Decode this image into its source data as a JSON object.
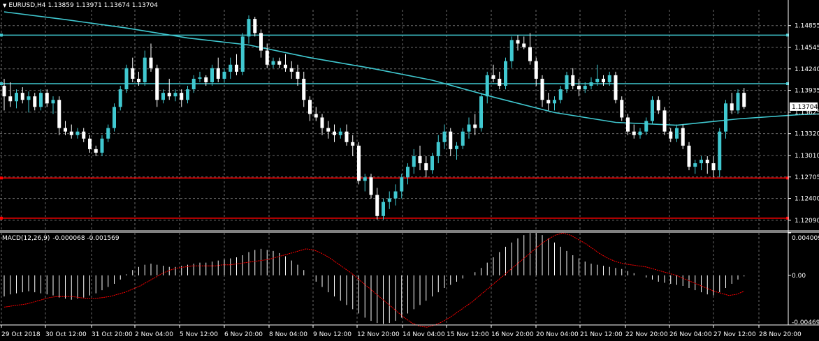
{
  "header": {
    "symbol_tf": "EURUSD,H4",
    "ohlc": "1.13859 1.13971 1.13674 1.13704"
  },
  "macd_header": {
    "name": "MACD(12,26,9)",
    "values": "-0.000068 -0.001569"
  },
  "price_axis": {
    "ticks": [
      "1.14855",
      "1.14545",
      "1.14240",
      "1.13935",
      "1.13625",
      "1.13320",
      "1.13010",
      "1.12705",
      "1.12400",
      "1.12090"
    ],
    "current_price_label": "1.13704"
  },
  "macd_axis": {
    "ticks": [
      "0.004009",
      "0.00",
      "-0.00469"
    ]
  },
  "time_axis": {
    "ticks": [
      "29 Oct 2018",
      "30 Oct 12:00",
      "31 Oct 20:00",
      "2 Nov 04:00",
      "5 Nov 12:00",
      "6 Nov 20:00",
      "8 Nov 04:00",
      "9 Nov 12:00",
      "12 Nov 20:00",
      "14 Nov 04:00",
      "15 Nov 12:00",
      "16 Nov 20:00",
      "20 Nov 04:00",
      "21 Nov 12:00",
      "22 Nov 20:00",
      "26 Nov 04:00",
      "27 Nov 12:00",
      "28 Nov 20:00"
    ]
  },
  "horizontal_lines": [
    {
      "kind": "resistance",
      "price": 1.1472,
      "color": "#40c8d0"
    },
    {
      "kind": "resistance",
      "price": 1.1403,
      "color": "#40c8d0"
    },
    {
      "kind": "support",
      "price": 1.1269,
      "color": "#ff0000"
    },
    {
      "kind": "support",
      "price": 1.1212,
      "color": "#ff0000"
    }
  ],
  "colors": {
    "background": "#000000",
    "grid": "#6a6a6a",
    "bull_candle": "#40c8d0",
    "bear_candle": "#ffffff",
    "moving_average": "#40c8d0",
    "macd_histogram": "#ffffff",
    "macd_signal": "#ff0000"
  },
  "chart_data": {
    "type": "candlestick",
    "symbol": "EURUSD",
    "timeframe": "H4",
    "title": "EURUSD,H4",
    "ylim": [
      1.1195,
      1.1508
    ],
    "x_range": [
      "29 Oct 2018",
      "28 Nov 20:00"
    ],
    "grid": true,
    "indicators": [
      {
        "name": "Moving Average",
        "points": [
          [
            0,
            1.1505
          ],
          [
            10,
            1.1494
          ],
          [
            20,
            1.1482
          ],
          [
            30,
            1.1468
          ],
          [
            40,
            1.1458
          ],
          [
            50,
            1.144
          ],
          [
            60,
            1.1425
          ],
          [
            70,
            1.1408
          ],
          [
            80,
            1.1384
          ],
          [
            90,
            1.1362
          ],
          [
            100,
            1.1348
          ],
          [
            110,
            1.1344
          ],
          [
            120,
            1.1353
          ],
          [
            130,
            1.1359
          ],
          [
            140,
            1.1362
          ],
          [
            150,
            1.1366
          ],
          [
            160,
            1.1365
          ],
          [
            170,
            1.1357
          ],
          [
            175,
            1.135
          ]
        ]
      },
      {
        "name": "MACD(12,26,9)",
        "main": -6.8e-05,
        "signal": -0.001569,
        "range": [
          -0.00469,
          0.004009
        ]
      }
    ],
    "candles": [
      [
        1.14,
        1.141,
        1.1365,
        1.1385
      ],
      [
        1.1385,
        1.1405,
        1.137,
        1.1378
      ],
      [
        1.1378,
        1.1395,
        1.1368,
        1.139
      ],
      [
        1.139,
        1.1398,
        1.1375,
        1.138
      ],
      [
        1.138,
        1.1392,
        1.1362,
        1.1385
      ],
      [
        1.1385,
        1.139,
        1.1365,
        1.137
      ],
      [
        1.137,
        1.1395,
        1.1365,
        1.139
      ],
      [
        1.139,
        1.1395,
        1.137,
        1.1375
      ],
      [
        1.1375,
        1.1385,
        1.136,
        1.138
      ],
      [
        1.138,
        1.1385,
        1.133,
        1.134
      ],
      [
        1.134,
        1.135,
        1.133,
        1.1335
      ],
      [
        1.1335,
        1.1345,
        1.1325,
        1.133
      ],
      [
        1.133,
        1.134,
        1.1325,
        1.1335
      ],
      [
        1.1335,
        1.134,
        1.132,
        1.1325
      ],
      [
        1.1325,
        1.133,
        1.1305,
        1.131
      ],
      [
        1.131,
        1.1315,
        1.13,
        1.1305
      ],
      [
        1.1305,
        1.133,
        1.13,
        1.1325
      ],
      [
        1.1325,
        1.1345,
        1.132,
        1.134
      ],
      [
        1.134,
        1.1375,
        1.1335,
        1.137
      ],
      [
        1.137,
        1.14,
        1.1365,
        1.1395
      ],
      [
        1.1395,
        1.143,
        1.139,
        1.1425
      ],
      [
        1.1425,
        1.144,
        1.1405,
        1.141
      ],
      [
        1.141,
        1.142,
        1.14,
        1.1405
      ],
      [
        1.1405,
        1.145,
        1.14,
        1.144
      ],
      [
        1.144,
        1.146,
        1.142,
        1.1425
      ],
      [
        1.1425,
        1.143,
        1.137,
        1.138
      ],
      [
        1.138,
        1.1395,
        1.1375,
        1.139
      ],
      [
        1.139,
        1.141,
        1.138,
        1.1385
      ],
      [
        1.1385,
        1.1395,
        1.1378,
        1.139
      ],
      [
        1.139,
        1.1395,
        1.137,
        1.138
      ],
      [
        1.138,
        1.14,
        1.1375,
        1.1395
      ],
      [
        1.1395,
        1.1415,
        1.139,
        1.141
      ],
      [
        1.141,
        1.142,
        1.1405,
        1.1412
      ],
      [
        1.1412,
        1.1415,
        1.14,
        1.1405
      ],
      [
        1.1405,
        1.143,
        1.14,
        1.1425
      ],
      [
        1.1425,
        1.144,
        1.1405,
        1.141
      ],
      [
        1.141,
        1.1425,
        1.1405,
        1.142
      ],
      [
        1.142,
        1.144,
        1.141,
        1.143
      ],
      [
        1.143,
        1.1445,
        1.1415,
        1.142
      ],
      [
        1.142,
        1.1475,
        1.1415,
        1.147
      ],
      [
        1.147,
        1.15,
        1.146,
        1.1495
      ],
      [
        1.1495,
        1.1498,
        1.147,
        1.1475
      ],
      [
        1.1475,
        1.148,
        1.144,
        1.145
      ],
      [
        1.145,
        1.146,
        1.1425,
        1.143
      ],
      [
        1.143,
        1.144,
        1.1425,
        1.1435
      ],
      [
        1.1435,
        1.144,
        1.1425,
        1.143
      ],
      [
        1.143,
        1.1445,
        1.142,
        1.1425
      ],
      [
        1.1425,
        1.1435,
        1.141,
        1.142
      ],
      [
        1.142,
        1.143,
        1.14,
        1.141
      ],
      [
        1.141,
        1.142,
        1.137,
        1.138
      ],
      [
        1.138,
        1.1385,
        1.135,
        1.136
      ],
      [
        1.136,
        1.137,
        1.135,
        1.1355
      ],
      [
        1.1355,
        1.136,
        1.133,
        1.134
      ],
      [
        1.134,
        1.135,
        1.1325,
        1.1335
      ],
      [
        1.1335,
        1.1345,
        1.132,
        1.133
      ],
      [
        1.133,
        1.134,
        1.1325,
        1.1335
      ],
      [
        1.1335,
        1.1345,
        1.1315,
        1.132
      ],
      [
        1.132,
        1.133,
        1.13,
        1.1315
      ],
      [
        1.1315,
        1.132,
        1.126,
        1.1265
      ],
      [
        1.1265,
        1.1275,
        1.125,
        1.127
      ],
      [
        1.127,
        1.1275,
        1.124,
        1.1245
      ],
      [
        1.1245,
        1.1255,
        1.121,
        1.1215
      ],
      [
        1.1215,
        1.124,
        1.121,
        1.1235
      ],
      [
        1.1235,
        1.125,
        1.1225,
        1.124
      ],
      [
        1.124,
        1.126,
        1.123,
        1.125
      ],
      [
        1.125,
        1.1275,
        1.124,
        1.127
      ],
      [
        1.127,
        1.129,
        1.126,
        1.1285
      ],
      [
        1.1285,
        1.131,
        1.1275,
        1.13
      ],
      [
        1.13,
        1.1315,
        1.128,
        1.129
      ],
      [
        1.129,
        1.13,
        1.127,
        1.128
      ],
      [
        1.128,
        1.1305,
        1.1275,
        1.13
      ],
      [
        1.13,
        1.133,
        1.129,
        1.132
      ],
      [
        1.132,
        1.1345,
        1.131,
        1.1335
      ],
      [
        1.1335,
        1.134,
        1.13,
        1.131
      ],
      [
        1.131,
        1.132,
        1.1295,
        1.1315
      ],
      [
        1.1315,
        1.134,
        1.131,
        1.1335
      ],
      [
        1.1335,
        1.1355,
        1.1325,
        1.1345
      ],
      [
        1.1345,
        1.136,
        1.133,
        1.134
      ],
      [
        1.134,
        1.139,
        1.1335,
        1.1385
      ],
      [
        1.1385,
        1.142,
        1.1375,
        1.1415
      ],
      [
        1.1415,
        1.143,
        1.1405,
        1.141
      ],
      [
        1.141,
        1.142,
        1.1395,
        1.14
      ],
      [
        1.14,
        1.144,
        1.1395,
        1.1435
      ],
      [
        1.1435,
        1.147,
        1.1425,
        1.1465
      ],
      [
        1.1465,
        1.1472,
        1.145,
        1.146
      ],
      [
        1.146,
        1.147,
        1.1452,
        1.1455
      ],
      [
        1.1455,
        1.1475,
        1.143,
        1.1435
      ],
      [
        1.1435,
        1.144,
        1.14,
        1.141
      ],
      [
        1.141,
        1.1415,
        1.137,
        1.138
      ],
      [
        1.138,
        1.139,
        1.1365,
        1.1375
      ],
      [
        1.1375,
        1.1385,
        1.1365,
        1.138
      ],
      [
        1.138,
        1.14,
        1.1375,
        1.1395
      ],
      [
        1.1395,
        1.142,
        1.139,
        1.1415
      ],
      [
        1.1415,
        1.1425,
        1.1395,
        1.14
      ],
      [
        1.14,
        1.141,
        1.1385,
        1.1395
      ],
      [
        1.1395,
        1.1405,
        1.139,
        1.14
      ],
      [
        1.14,
        1.1412,
        1.1395,
        1.1405
      ],
      [
        1.1405,
        1.143,
        1.14,
        1.141
      ],
      [
        1.141,
        1.1415,
        1.14,
        1.1405
      ],
      [
        1.1405,
        1.142,
        1.14,
        1.1415
      ],
      [
        1.1415,
        1.142,
        1.1375,
        1.138
      ],
      [
        1.138,
        1.1385,
        1.135,
        1.1355
      ],
      [
        1.1355,
        1.136,
        1.133,
        1.1335
      ],
      [
        1.1335,
        1.1345,
        1.1325,
        1.133
      ],
      [
        1.133,
        1.134,
        1.1325,
        1.1335
      ],
      [
        1.1335,
        1.1355,
        1.133,
        1.135
      ],
      [
        1.135,
        1.1385,
        1.1345,
        1.138
      ],
      [
        1.138,
        1.1385,
        1.136,
        1.1365
      ],
      [
        1.1365,
        1.137,
        1.133,
        1.1335
      ],
      [
        1.1335,
        1.134,
        1.132,
        1.1325
      ],
      [
        1.1325,
        1.1345,
        1.132,
        1.134
      ],
      [
        1.134,
        1.1345,
        1.131,
        1.1315
      ],
      [
        1.1315,
        1.132,
        1.128,
        1.1285
      ],
      [
        1.1285,
        1.1295,
        1.1275,
        1.129
      ],
      [
        1.129,
        1.13,
        1.128,
        1.1295
      ],
      [
        1.1295,
        1.13,
        1.1275,
        1.129
      ],
      [
        1.129,
        1.13,
        1.127,
        1.128
      ],
      [
        1.128,
        1.134,
        1.127,
        1.1335
      ],
      [
        1.1335,
        1.138,
        1.1325,
        1.1375
      ],
      [
        1.1375,
        1.139,
        1.136,
        1.1365
      ],
      [
        1.1365,
        1.1395,
        1.136,
        1.139
      ],
      [
        1.139,
        1.1397,
        1.1367,
        1.137
      ]
    ],
    "macd_histogram": [
      -0.002,
      -0.0018,
      -0.0017,
      -0.0016,
      -0.0015,
      -0.0016,
      -0.0017,
      -0.0018,
      -0.0019,
      -0.0021,
      -0.0022,
      -0.0023,
      -0.0022,
      -0.0021,
      -0.0019,
      -0.0017,
      -0.0014,
      -0.0011,
      -0.0008,
      -0.0004,
      0.0001,
      0.0005,
      0.0008,
      0.001,
      0.0011,
      0.001,
      0.0009,
      0.0008,
      0.0008,
      0.0009,
      0.001,
      0.0011,
      0.0012,
      0.0012,
      0.0013,
      0.0014,
      0.0015,
      0.0016,
      0.0017,
      0.0019,
      0.0022,
      0.0024,
      0.0025,
      0.0024,
      0.0023,
      0.0021,
      0.0018,
      0.0014,
      0.001,
      0.0005,
      0.0,
      -0.0006,
      -0.0011,
      -0.0016,
      -0.002,
      -0.0024,
      -0.0028,
      -0.0032,
      -0.0036,
      -0.004,
      -0.0043,
      -0.0045,
      -0.0046,
      -0.0045,
      -0.0043,
      -0.004,
      -0.0036,
      -0.0032,
      -0.0028,
      -0.0024,
      -0.002,
      -0.0016,
      -0.0012,
      -0.0009,
      -0.0006,
      -0.0003,
      0.0,
      0.0003,
      0.0007,
      0.0012,
      0.0017,
      0.0022,
      0.0027,
      0.0031,
      0.0035,
      0.0038,
      0.004,
      0.004,
      0.0038,
      0.0035,
      0.0031,
      0.0027,
      0.0023,
      0.0019,
      0.0016,
      0.0013,
      0.0011,
      0.001,
      0.0009,
      0.0008,
      0.0007,
      0.0006,
      0.0004,
      0.0002,
      0.0,
      -0.0002,
      -0.0004,
      -0.0006,
      -0.0007,
      -0.0008,
      -0.0009,
      -0.001,
      -0.0012,
      -0.0014,
      -0.0016,
      -0.0018,
      -0.0019,
      -0.0016,
      -0.0012,
      -0.0008,
      -0.0004,
      -0.0001
    ],
    "macd_signal": [
      -0.003,
      -0.0029,
      -0.0028,
      -0.0027,
      -0.0025,
      -0.0023,
      -0.0021,
      -0.002,
      -0.002,
      -0.002,
      -0.0021,
      -0.0022,
      -0.0022,
      -0.0021,
      -0.002,
      -0.0018,
      -0.0016,
      -0.0013,
      -0.001,
      -0.0006,
      -0.0002,
      0.0002,
      0.0005,
      0.0007,
      0.0008,
      0.0009,
      0.0009,
      0.0009,
      0.0009,
      0.001,
      0.001,
      0.0011,
      0.0012,
      0.0013,
      0.0014,
      0.0015,
      0.0017,
      0.0019,
      0.0021,
      0.0023,
      0.0025,
      0.0024,
      0.0021,
      0.0017,
      0.0012,
      0.0007,
      0.0002,
      -0.0004,
      -0.001,
      -0.0016,
      -0.0022,
      -0.0028,
      -0.0034,
      -0.004,
      -0.0045,
      -0.0048,
      -0.0049,
      -0.0047,
      -0.0044,
      -0.004,
      -0.0035,
      -0.003,
      -0.0025,
      -0.0019,
      -0.0013,
      -0.0007,
      -0.0001,
      0.0005,
      0.0011,
      0.0017,
      0.0023,
      0.0029,
      0.0034,
      0.0038,
      0.004,
      0.0038,
      0.0034,
      0.003,
      0.0025,
      0.002,
      0.0016,
      0.0013,
      0.0011,
      0.001,
      0.0009,
      0.0008,
      0.0006,
      0.0004,
      0.0002,
      0.0,
      -0.0003,
      -0.0006,
      -0.0009,
      -0.0012,
      -0.0015,
      -0.0017,
      -0.0019,
      -0.0018,
      -0.0015
    ]
  }
}
